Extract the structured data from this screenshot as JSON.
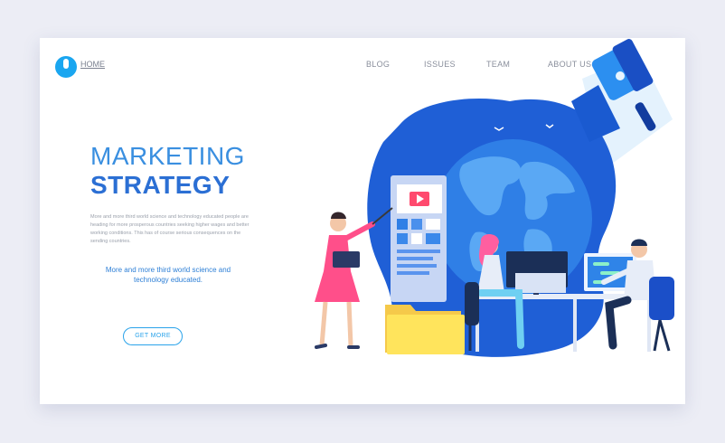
{
  "nav": {
    "home_label": "HOME",
    "items": [
      {
        "label": "BLOG"
      },
      {
        "label": "ISSUES"
      },
      {
        "label": "TEAM"
      },
      {
        "label": "ABOUT US"
      }
    ]
  },
  "hero": {
    "title_line1": "MARKETING",
    "title_line2": "STRATEGY",
    "body": "More and more third world science and technology educated people are heading for more prosperous countries seeking higher wages and better working conditions. This has of course serious consequences on the sending countries.",
    "subtext": "More and more third world science and technology educated.",
    "cta_label": "GET MORE"
  },
  "colors": {
    "background": "#ecedf5",
    "accent": "#1aa6f0",
    "title": "#3a8fe0",
    "blob": "#1f5fd6",
    "folder": "#ffe45c"
  },
  "icons": [
    "logo-icon",
    "megaphone-icon",
    "play-icon",
    "globe-icon",
    "folder-icon"
  ]
}
